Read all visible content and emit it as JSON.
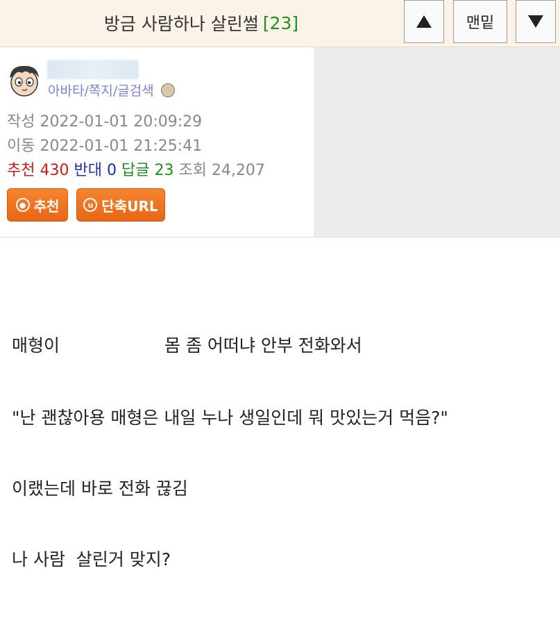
{
  "header": {
    "title": "방금 사람하나 살린썰",
    "reply_count": "[23]",
    "bottom_label": "맨밑"
  },
  "author": {
    "links": [
      "아바타",
      "쪽지",
      "글검색"
    ],
    "sep": "/"
  },
  "meta": {
    "written_label": "작성",
    "written": "2022-01-01 20:09:29",
    "moved_label": "이동",
    "moved": "2022-01-01 21:25:41",
    "recommend_label": "추천",
    "recommend": "430",
    "oppose_label": "반대",
    "oppose": "0",
    "replies_label": "답글",
    "replies": "23",
    "views_label": "조회",
    "views": "24,207"
  },
  "actions": {
    "recommend_label": "추천",
    "short_url_label": "단축URL"
  },
  "content": {
    "lines": [
      "매형이                   몸 좀 어떠냐 안부 전화와서",
      "\"난 괜찮아용 매형은 내일 누나 생일인데 뭐 맛있는거 먹음?\"",
      "이랬는데 바로 전화 끊김",
      "나 사람  살린거 맞지?"
    ]
  },
  "colors": {
    "header_bg": "#fbf2e8",
    "accent_orange": "#ee6c1c",
    "recommend_red": "#cc1b1b",
    "oppose_blue": "#1a2fb0",
    "reply_green": "#1f8f1f",
    "link_purple": "#7a85cf"
  }
}
